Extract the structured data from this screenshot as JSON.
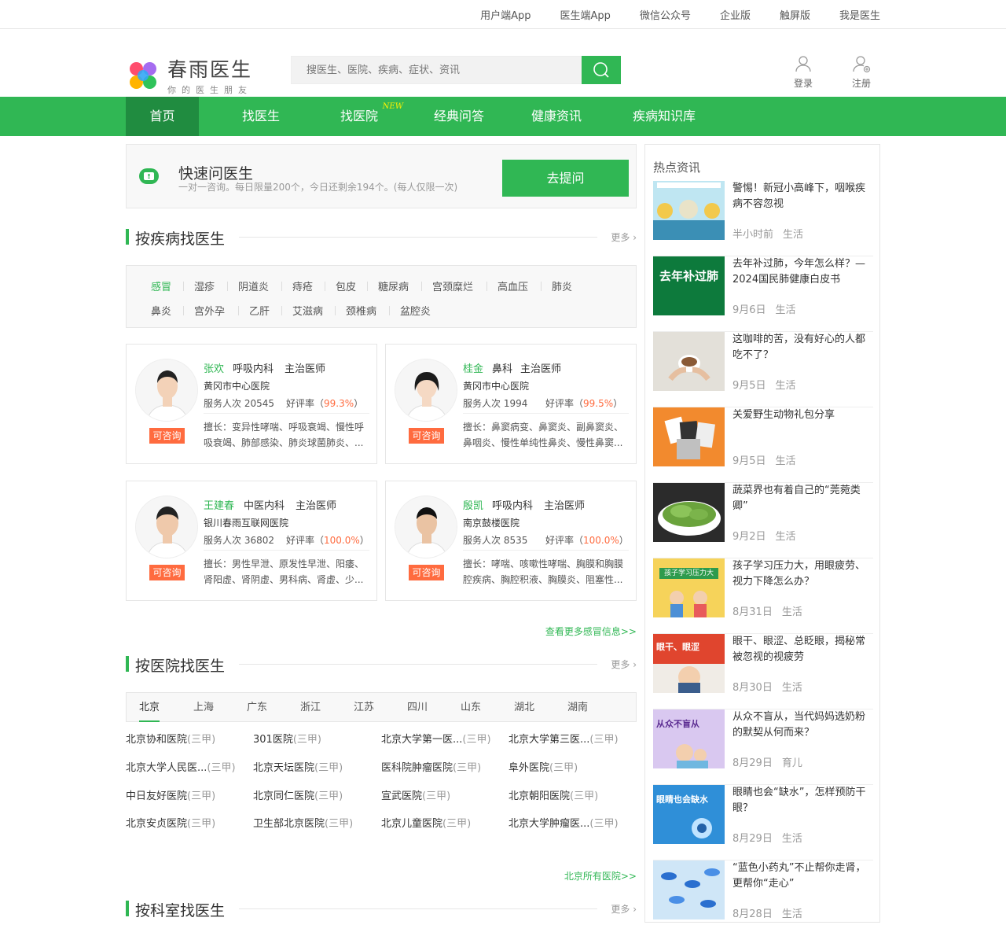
{
  "topbar": {
    "links": [
      "用户端App",
      "医生端App",
      "微信公众号",
      "企业版",
      "触屏版",
      "我是医生"
    ]
  },
  "logo": {
    "brand": "春雨医生",
    "slogan": "你的医生朋友"
  },
  "search": {
    "placeholder": "搜医生、医院、疾病、症状、资讯"
  },
  "user": {
    "login": "登录",
    "register": "注册"
  },
  "nav": {
    "items": [
      "首页",
      "找医生",
      "找医院",
      "经典问答",
      "健康资讯",
      "疾病知识库"
    ],
    "new_badge": "NEW"
  },
  "quick": {
    "title": "快速问医生",
    "desc": "一对一咨询。每日限量200个，今日还剩余194个。(每人仅限一次)",
    "button": "去提问"
  },
  "disease_section": {
    "title": "按疾病找医生",
    "more": "更多",
    "tags": [
      "感冒",
      "湿疹",
      "阴道炎",
      "痔疮",
      "包皮",
      "糖尿病",
      "宫颈糜烂",
      "高血压",
      "肺炎",
      "鼻炎",
      "宫外孕",
      "乙肝",
      "艾滋病",
      "颈椎病",
      "盆腔炎"
    ]
  },
  "doctors": [
    {
      "name": "张欢",
      "dept": "呼吸内科",
      "title": "主治医师",
      "hospital": "黄冈市中心医院",
      "served_label": "服务人次",
      "served": "20545",
      "rate_label": "好评率",
      "rate": "99.3%",
      "skill": "擅长：变异性哮喘、呼吸衰竭、慢性呼吸衰竭、肺部感染、肺炎球菌肺炎、...",
      "badge": "可咨询"
    },
    {
      "name": "桂金",
      "dept": "鼻科",
      "title": "主治医师",
      "hospital": "黄冈市中心医院",
      "served_label": "服务人次",
      "served": "1994",
      "rate_label": "好评率",
      "rate": "99.5%",
      "skill": "擅长：鼻窦病变、鼻窦炎、副鼻窦炎、鼻咽炎、慢性单纯性鼻炎、慢性鼻窦...",
      "badge": "可咨询"
    },
    {
      "name": "王建春",
      "dept": "中医内科",
      "title": "主治医师",
      "hospital": "银川春雨互联网医院",
      "served_label": "服务人次",
      "served": "36802",
      "rate_label": "好评率",
      "rate": "100.0%",
      "skill": "擅长：男性早泄、原发性早泄、阳痿、肾阳虚、肾阴虚、男科病、肾虚、少...",
      "badge": "可咨询"
    },
    {
      "name": "殷凯",
      "dept": "呼吸内科",
      "title": "主治医师",
      "hospital": "南京鼓楼医院",
      "served_label": "服务人次",
      "served": "8535",
      "rate_label": "好评率",
      "rate": "100.0%",
      "skill": "擅长：哮喘、咳嗽性哮喘、胸膜和胸膜腔疾病、胸腔积液、胸膜炎、阻塞性...",
      "badge": "可咨询"
    }
  ],
  "more_cold": "查看更多感冒信息>>",
  "hospital_section": {
    "title": "按医院找医生",
    "more": "更多",
    "cities": [
      "北京",
      "上海",
      "广东",
      "浙江",
      "江苏",
      "四川",
      "山东",
      "湖北",
      "湖南"
    ],
    "hospitals": [
      {
        "name": "北京协和医院",
        "level": "(三甲)"
      },
      {
        "name": "301医院",
        "level": "(三甲)"
      },
      {
        "name": "北京大学第一医...",
        "level": "(三甲)"
      },
      {
        "name": "北京大学第三医...",
        "level": "(三甲)"
      },
      {
        "name": "北京大学人民医...",
        "level": "(三甲)"
      },
      {
        "name": "北京天坛医院",
        "level": "(三甲)"
      },
      {
        "name": "医科院肿瘤医院",
        "level": "(三甲)"
      },
      {
        "name": "阜外医院",
        "level": "(三甲)"
      },
      {
        "name": "中日友好医院",
        "level": "(三甲)"
      },
      {
        "name": "北京同仁医院",
        "level": "(三甲)"
      },
      {
        "name": "宣武医院",
        "level": "(三甲)"
      },
      {
        "name": "北京朝阳医院",
        "level": "(三甲)"
      },
      {
        "name": "北京安贞医院",
        "level": "(三甲)"
      },
      {
        "name": "卫生部北京医院",
        "level": "(三甲)"
      },
      {
        "name": "北京儿童医院",
        "level": "(三甲)"
      },
      {
        "name": "北京大学肿瘤医...",
        "level": "(三甲)"
      }
    ],
    "all_link": "北京所有医院>>"
  },
  "dept_section": {
    "title": "按科室找医生",
    "more": "更多"
  },
  "sidebar": {
    "title": "热点资讯",
    "news": [
      {
        "title": "警惕！新冠小高峰下，咽喉疾病不容忽视",
        "time": "半小时前",
        "cat": "生活",
        "thumb_text": ""
      },
      {
        "title": "去年补过肺，今年怎么样？—2024国民肺健康白皮书",
        "time": "9月6日",
        "cat": "生活",
        "thumb_text": "去年补过肺"
      },
      {
        "title": "这咖啡的苦，没有好心的人都吃不了？",
        "time": "9月5日",
        "cat": "生活",
        "thumb_text": ""
      },
      {
        "title": "关爱野生动物礼包分享",
        "time": "9月5日",
        "cat": "生活",
        "thumb_text": ""
      },
      {
        "title": "蔬菜界也有着自己的“莞菀类卿”",
        "time": "9月2日",
        "cat": "生活",
        "thumb_text": ""
      },
      {
        "title": "孩子学习压力大，用眼疲劳、视力下降怎么办？",
        "time": "8月31日",
        "cat": "生活",
        "thumb_text": "孩子学习压力大"
      },
      {
        "title": "眼干、眼涩、总眨眼，揭秘常被忽视的视疲劳",
        "time": "8月30日",
        "cat": "生活",
        "thumb_text": "眼干、眼涩"
      },
      {
        "title": "从众不盲从，当代妈妈选奶粉的默契从何而来？",
        "time": "8月29日",
        "cat": "育儿",
        "thumb_text": "从众不盲从"
      },
      {
        "title": "眼睛也会“缺水”，怎样预防干眼？",
        "time": "8月29日",
        "cat": "生活",
        "thumb_text": "眼睛也会缺水"
      },
      {
        "title": "“蓝色小药丸”不止帮你走肾，更帮你“走心”",
        "time": "8月28日",
        "cat": "生活",
        "thumb_text": ""
      }
    ]
  },
  "colors": {
    "brand": "#30b754",
    "brand_dark": "#208c40",
    "accent": "#ff6b3f"
  }
}
